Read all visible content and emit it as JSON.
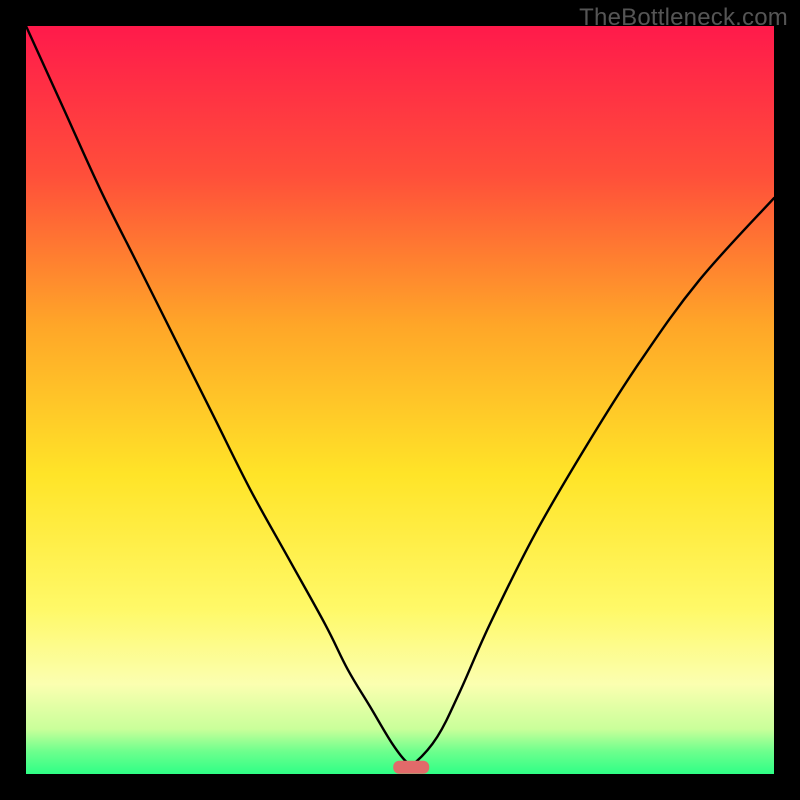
{
  "watermark": "TheBottleneck.com",
  "chart_data": {
    "type": "line",
    "title": "",
    "xlabel": "",
    "ylabel": "",
    "xlim": [
      0,
      100
    ],
    "ylim": [
      0,
      100
    ],
    "grid": false,
    "series": [
      {
        "name": "curve",
        "x": [
          0,
          5,
          10,
          15,
          20,
          25,
          30,
          35,
          40,
          43,
          46,
          49,
          51,
          52,
          55,
          58,
          62,
          68,
          75,
          82,
          90,
          100
        ],
        "values": [
          100,
          89,
          78,
          68,
          58,
          48,
          38,
          29,
          20,
          14,
          9,
          4,
          1.5,
          1.5,
          5,
          11,
          20,
          32,
          44,
          55,
          66,
          77
        ]
      }
    ],
    "marker": {
      "x": 51.5,
      "y": 0.9,
      "color": "#e26a6a"
    },
    "gradient_stops": [
      {
        "offset": 0.0,
        "color": "#ff1a4b"
      },
      {
        "offset": 0.2,
        "color": "#ff4f3a"
      },
      {
        "offset": 0.4,
        "color": "#ffa628"
      },
      {
        "offset": 0.6,
        "color": "#ffe428"
      },
      {
        "offset": 0.78,
        "color": "#fff968"
      },
      {
        "offset": 0.88,
        "color": "#fbffb0"
      },
      {
        "offset": 0.94,
        "color": "#c9ff9a"
      },
      {
        "offset": 0.97,
        "color": "#6dff8d"
      },
      {
        "offset": 1.0,
        "color": "#2fff86"
      }
    ]
  }
}
